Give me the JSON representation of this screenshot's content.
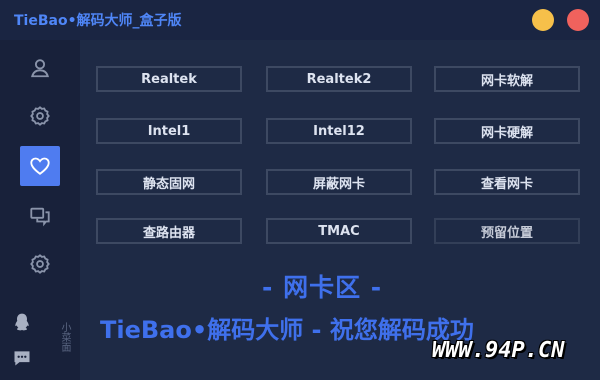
{
  "app": {
    "title": "TieBao•解码大师_盒子版"
  },
  "window_controls": {
    "minimize_color": "#f6c04a",
    "close_color": "#f0625d"
  },
  "sidebar": {
    "items": [
      {
        "name": "user",
        "icon": "user-icon",
        "active": false
      },
      {
        "name": "settings",
        "icon": "gear-icon",
        "active": false
      },
      {
        "name": "favorite",
        "icon": "heart-icon",
        "active": true
      },
      {
        "name": "chat",
        "icon": "chat-icon",
        "active": false
      },
      {
        "name": "settings-2",
        "icon": "gear-icon",
        "active": false
      }
    ],
    "bottom_icons": [
      "qq-icon",
      "message-icon"
    ],
    "vertical_text": "小菜面"
  },
  "buttons": [
    [
      "Realtek",
      "Realtek2",
      "网卡软解"
    ],
    [
      "Intel1",
      "Intel12",
      "网卡硬解"
    ],
    [
      "静态固网",
      "屏蔽网卡",
      "查看网卡"
    ],
    [
      "查路由器",
      "TMAC",
      "预留位置"
    ]
  ],
  "banner": {
    "line1": "- 网卡区 -",
    "line2": "TieBao•解码大师 - 祝您解码成功"
  },
  "watermark": "WWW.94P.CN",
  "colors": {
    "accent": "#4f7cf0",
    "background": "#1e2a45",
    "sidebar": "#18213a"
  }
}
